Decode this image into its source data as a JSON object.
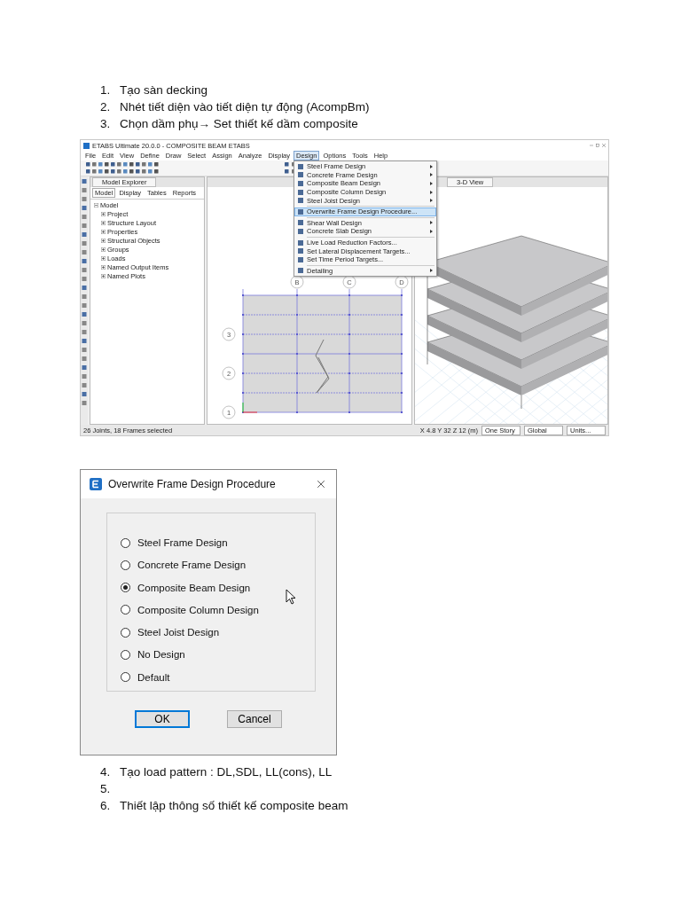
{
  "steps_top": [
    {
      "number": "1.",
      "text": "Tạo sàn decking"
    },
    {
      "number": "2.",
      "text": "Nhét tiết diện vào tiết diện tự động (AcompBm)"
    },
    {
      "number": "3.",
      "text": "Chọn dầm phụ→ Set thiết kế dầm composite"
    }
  ],
  "etabs_window": {
    "title": "ETABS Ultimate 20.0.0 - COMPOSITE BEAM ETABS",
    "menu": [
      {
        "label": "File",
        "selected": false
      },
      {
        "label": "Edit",
        "selected": false
      },
      {
        "label": "View",
        "selected": false
      },
      {
        "label": "Define",
        "selected": false
      },
      {
        "label": "Draw",
        "selected": false
      },
      {
        "label": "Select",
        "selected": false
      },
      {
        "label": "Assign",
        "selected": false
      },
      {
        "label": "Analyze",
        "selected": false
      },
      {
        "label": "Display",
        "selected": false
      },
      {
        "label": "Design",
        "selected": true
      },
      {
        "label": "Options",
        "selected": false
      },
      {
        "label": "Tools",
        "selected": false
      },
      {
        "label": "Help",
        "selected": false
      }
    ],
    "design_menu": [
      {
        "kind": "item",
        "label": "Steel Frame Design",
        "submenu": true,
        "highlighted": false
      },
      {
        "kind": "item",
        "label": "Concrete Frame Design",
        "submenu": true,
        "highlighted": false
      },
      {
        "kind": "item",
        "label": "Composite Beam Design",
        "submenu": true,
        "highlighted": false
      },
      {
        "kind": "item",
        "label": "Composite Column Design",
        "submenu": true,
        "highlighted": false
      },
      {
        "kind": "item",
        "label": "Steel Joist Design",
        "submenu": true,
        "highlighted": false
      },
      {
        "kind": "separator"
      },
      {
        "kind": "item",
        "label": "Overwrite Frame Design Procedure...",
        "submenu": false,
        "highlighted": true
      },
      {
        "kind": "separator"
      },
      {
        "kind": "item",
        "label": "Shear Wall Design",
        "submenu": true,
        "highlighted": false
      },
      {
        "kind": "item",
        "label": "Concrete Slab Design",
        "submenu": true,
        "highlighted": false
      },
      {
        "kind": "separator"
      },
      {
        "kind": "item",
        "label": "Live Load Reduction Factors...",
        "submenu": false,
        "highlighted": false
      },
      {
        "kind": "item",
        "label": "Set Lateral Displacement Targets...",
        "submenu": false,
        "highlighted": false
      },
      {
        "kind": "item",
        "label": "Set Time Period Targets...",
        "submenu": false,
        "highlighted": false
      },
      {
        "kind": "separator"
      },
      {
        "kind": "item",
        "label": "Detailing",
        "submenu": true,
        "highlighted": false
      }
    ],
    "model_explorer": {
      "title": "Model Explorer",
      "tabs": [
        {
          "label": "Model",
          "selected": true
        },
        {
          "label": "Display",
          "selected": false
        },
        {
          "label": "Tables",
          "selected": false
        },
        {
          "label": "Reports",
          "selected": false
        }
      ],
      "tree": [
        {
          "label": "Model",
          "expanded": true,
          "children": [
            {
              "label": "Project",
              "expanded": false
            },
            {
              "label": "Structure Layout",
              "expanded": false
            },
            {
              "label": "Properties",
              "expanded": false
            },
            {
              "label": "Structural Objects",
              "expanded": false
            },
            {
              "label": "Groups",
              "expanded": false
            },
            {
              "label": "Loads",
              "expanded": false
            },
            {
              "label": "Named Output Items",
              "expanded": false
            },
            {
              "label": "Named Plots",
              "expanded": false
            }
          ]
        }
      ]
    },
    "plan_view": {
      "column_bubbles": [
        "B",
        "C",
        "D"
      ],
      "row_bubbles": [
        "3",
        "2",
        "1"
      ]
    },
    "view_3d": {
      "title": "3-D View"
    },
    "status_bar": {
      "selection": "26 Joints, 18 Frames selected",
      "coordinates": "X 4.8  Y 32  Z 12 (m)",
      "story": "One Story",
      "system": "Global",
      "units": "Units..."
    }
  },
  "dialog": {
    "title": "Overwrite Frame Design Procedure",
    "options": [
      {
        "label": "Steel Frame Design",
        "selected": false
      },
      {
        "label": "Concrete Frame Design",
        "selected": false
      },
      {
        "label": "Composite Beam Design",
        "selected": true
      },
      {
        "label": "Composite Column Design",
        "selected": false
      },
      {
        "label": "Steel Joist Design",
        "selected": false
      },
      {
        "label": "No Design",
        "selected": false
      },
      {
        "label": "Default",
        "selected": false
      }
    ],
    "buttons": [
      {
        "label": "OK",
        "default": true
      },
      {
        "label": "Cancel",
        "default": false
      }
    ]
  },
  "steps_bottom": [
    {
      "number": "4.",
      "text": "Tạo load pattern : DL,SDL, LL(cons), LL"
    },
    {
      "number": "5."
    },
    {
      "number": "6.",
      "text": "Thiết lập thông số thiết kế composite beam"
    }
  ]
}
